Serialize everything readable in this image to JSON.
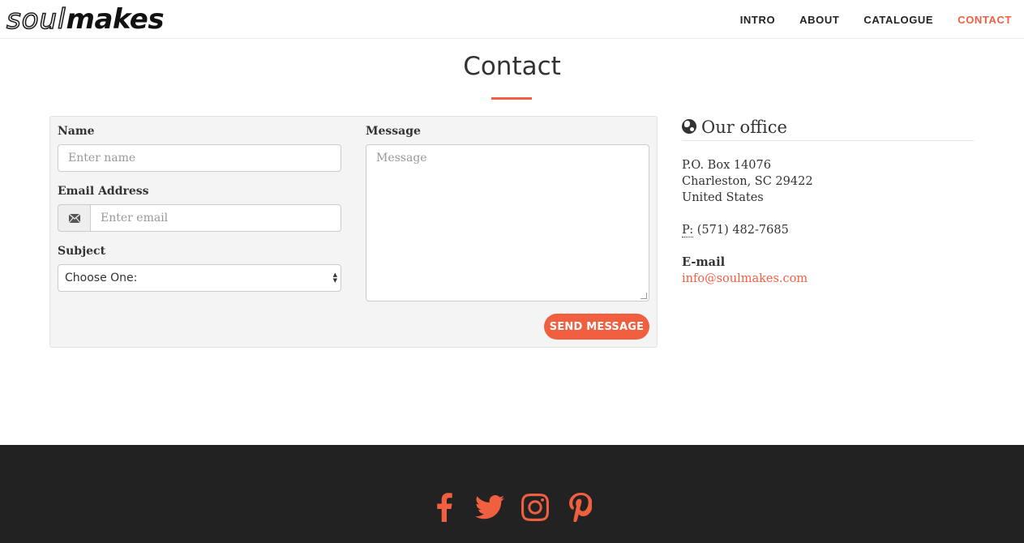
{
  "brand": {
    "logo_part1": "soul",
    "logo_part2": "makes"
  },
  "nav": {
    "items": [
      {
        "label": "INTRO"
      },
      {
        "label": "ABOUT"
      },
      {
        "label": "CATALOGUE"
      },
      {
        "label": "CONTACT"
      }
    ],
    "active": "CONTACT"
  },
  "page": {
    "title": "Contact"
  },
  "form": {
    "name_label": "Name",
    "name_placeholder": "Enter name",
    "email_label": "Email Address",
    "email_placeholder": "Enter email",
    "subject_label": "Subject",
    "subject_value": "Choose One:",
    "message_label": "Message",
    "message_placeholder": "Message",
    "send_label": "SEND MESSAGE"
  },
  "office": {
    "title": "Our office",
    "address_line1": "P.O. Box 14076",
    "address_line2": "Charleston, SC 29422",
    "address_line3": "United States",
    "phone_abbr": "P:",
    "phone": "(571) 482-7685",
    "email_label": "E-mail",
    "email": "info@soulmakes.com"
  },
  "footer": {
    "social_icons": [
      "facebook-icon",
      "twitter-icon",
      "instagram-icon",
      "pinterest-icon"
    ]
  },
  "colors": {
    "accent": "#f05f40",
    "footer_bg": "#222222",
    "panel_bg": "#f4f4f4"
  }
}
